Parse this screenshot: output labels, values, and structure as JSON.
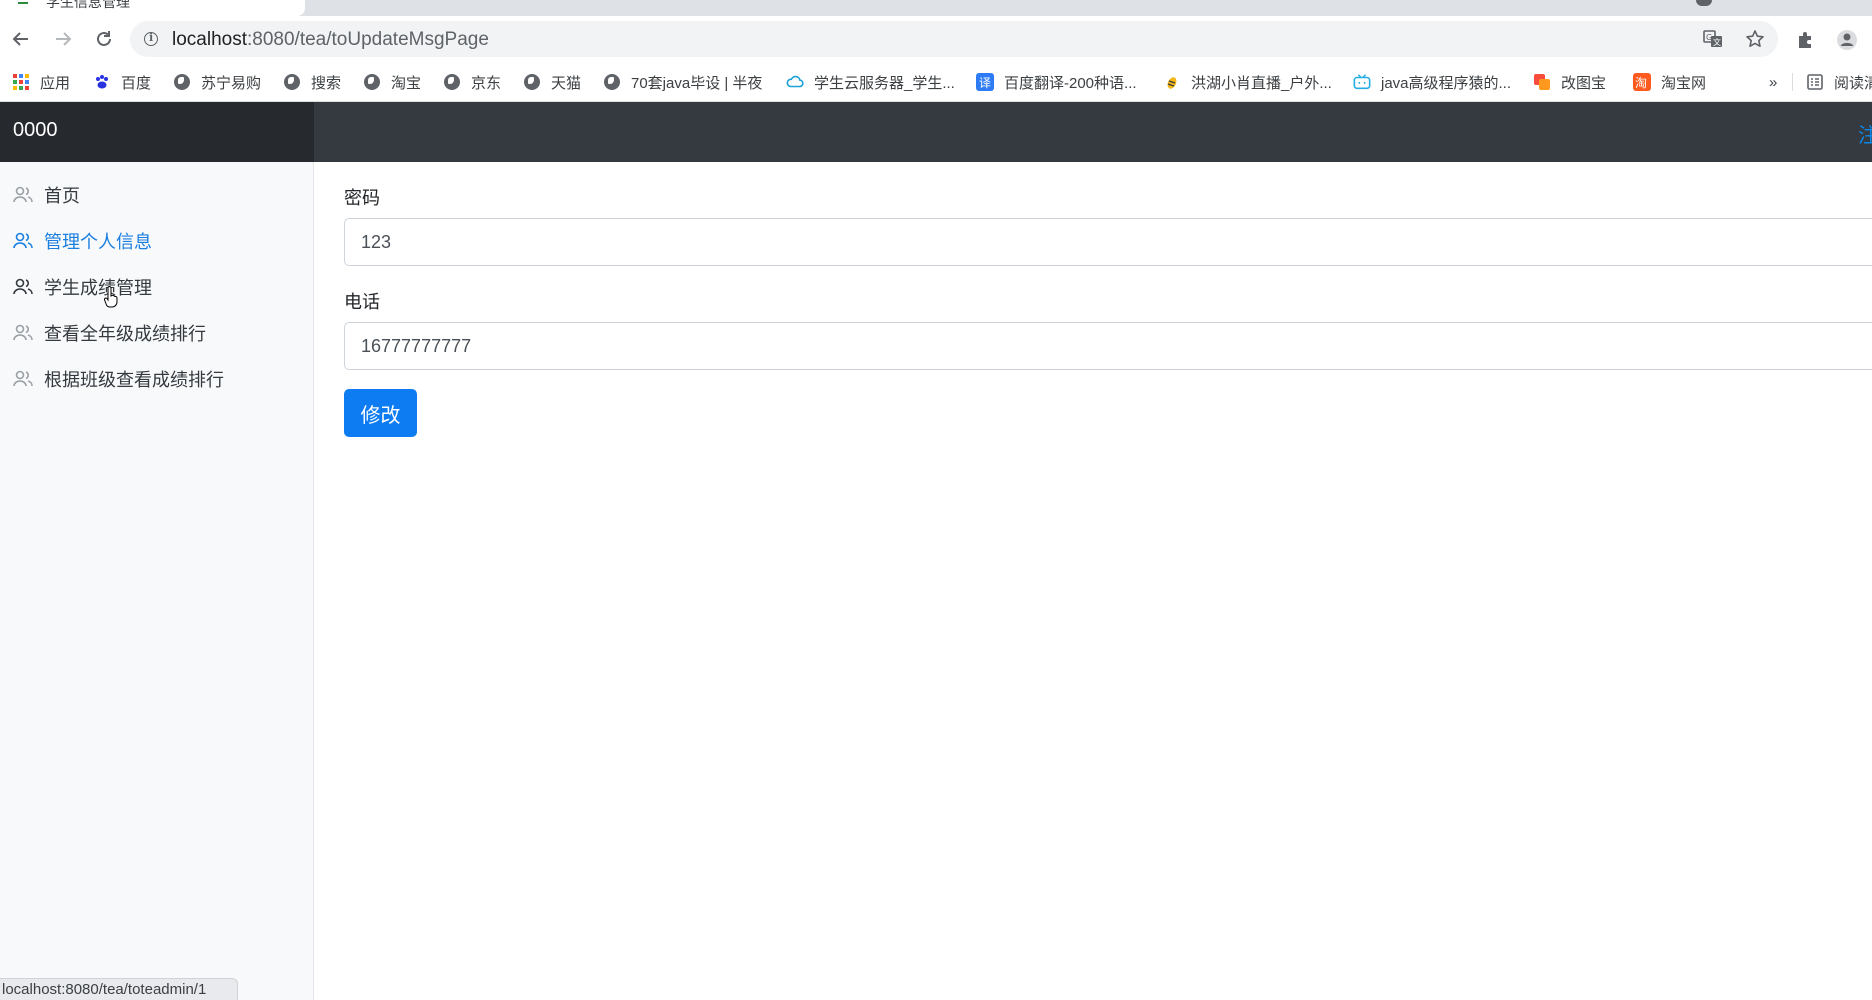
{
  "browser": {
    "tab_title": "学生信息管理",
    "url_host": "localhost",
    "url_path": ":8080/tea/toUpdateMsgPage",
    "status_url": "localhost:8080/tea/toteadmin/1"
  },
  "bookmarks": [
    {
      "label": "应用",
      "icon": "apps-icon"
    },
    {
      "label": "百度",
      "icon": "baidu-paw-icon"
    },
    {
      "label": "苏宁易购",
      "icon": "globe-icon"
    },
    {
      "label": "搜索",
      "icon": "globe-icon"
    },
    {
      "label": "淘宝",
      "icon": "globe-icon"
    },
    {
      "label": "京东",
      "icon": "globe-icon"
    },
    {
      "label": "天猫",
      "icon": "globe-icon"
    },
    {
      "label": "70套java毕设 | 半夜",
      "icon": "globe-icon"
    },
    {
      "label": "学生云服务器_学生...",
      "icon": "cloud-icon"
    },
    {
      "label": "百度翻译-200种语...",
      "icon": "translate-icon"
    },
    {
      "label": "洪湖小肖直播_户外...",
      "icon": "bee-icon"
    },
    {
      "label": "java高级程序猿的...",
      "icon": "bilibili-icon"
    },
    {
      "label": "改图宝",
      "icon": "gaitubao-icon"
    },
    {
      "label": "淘宝网",
      "icon": "taobao-icon"
    },
    {
      "label": "阅读清单",
      "icon": "reading-list-icon"
    }
  ],
  "bookmarks_overflow": "»",
  "app": {
    "brand": "0000",
    "signout": "注销"
  },
  "sidebar": {
    "items": [
      {
        "label": "首页",
        "active": false
      },
      {
        "label": "管理个人信息",
        "active": true
      },
      {
        "label": "学生成绩管理",
        "active": false
      },
      {
        "label": "查看全年级成绩排行",
        "active": false
      },
      {
        "label": "根据班级查看成绩排行",
        "active": false
      }
    ]
  },
  "form": {
    "password_label": "密码",
    "password_value": "123",
    "phone_label": "电话",
    "phone_value": "16777777777",
    "submit_label": "修改"
  },
  "colors": {
    "accent": "#0d7cf2",
    "sidebar_active": "#1a7fe0",
    "header": "#343a40",
    "brand_bg": "#26292d"
  }
}
